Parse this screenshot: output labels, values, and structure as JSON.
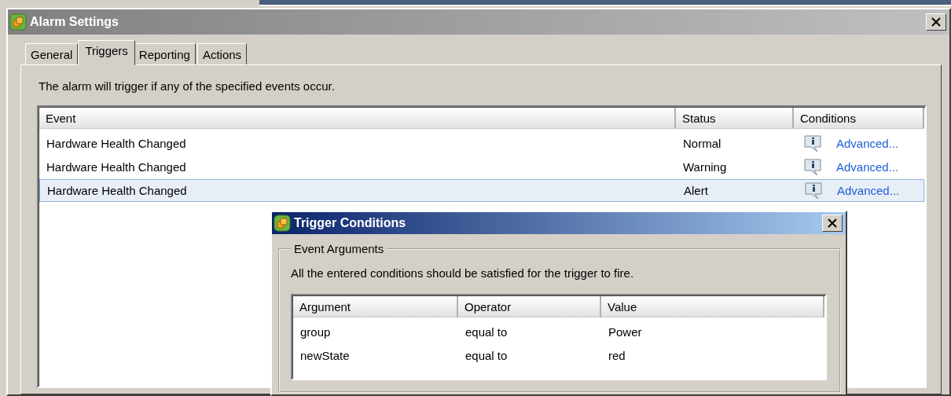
{
  "alarm_settings": {
    "title": "Alarm Settings",
    "active": false,
    "tabs": [
      {
        "label": "General",
        "selected": false
      },
      {
        "label": "Triggers",
        "selected": true
      },
      {
        "label": "Reporting",
        "selected": false
      },
      {
        "label": "Actions",
        "selected": false
      }
    ],
    "description": "The alarm will trigger if any of the specified events occur.",
    "table": {
      "columns": [
        "Event",
        "Status",
        "Conditions"
      ],
      "rows": [
        {
          "event": "Hardware Health Changed",
          "status": "Normal",
          "conditions": "Advanced...",
          "selected": false
        },
        {
          "event": "Hardware Health Changed",
          "status": "Warning",
          "conditions": "Advanced...",
          "selected": false
        },
        {
          "event": "Hardware Health Changed",
          "status": "Alert",
          "conditions": "Advanced...",
          "selected": true
        }
      ]
    }
  },
  "trigger_conditions": {
    "title": "Trigger Conditions",
    "active": true,
    "group_label": "Event Arguments",
    "description": "All the entered conditions should be satisfied for the trigger to fire.",
    "table": {
      "columns": [
        "Argument",
        "Operator",
        "Value"
      ],
      "rows": [
        {
          "argument": "group",
          "operator": "equal to",
          "value": "Power"
        },
        {
          "argument": "newState",
          "operator": "equal to",
          "value": "red"
        }
      ]
    }
  }
}
